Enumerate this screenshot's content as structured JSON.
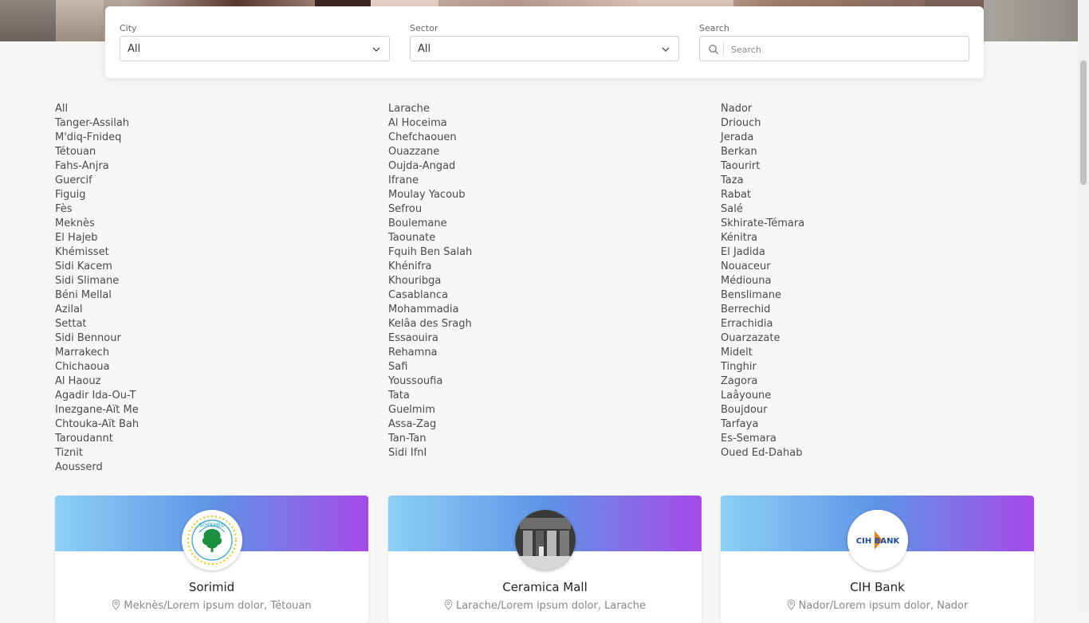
{
  "filters": {
    "city": {
      "label": "City",
      "value": "All"
    },
    "sector": {
      "label": "Sector",
      "value": "All"
    },
    "search": {
      "label": "Search",
      "placeholder": "Search"
    }
  },
  "cities": {
    "col1": [
      "All",
      "Tanger-Assilah",
      "M'diq-Fnideq",
      "Tétouan",
      "Fahs-Anjra",
      "Guercif",
      "Figuig",
      "Fès",
      "Meknès",
      "El Hajeb",
      "Khémisset",
      "Sidi Kacem",
      "Sidi Slimane",
      "Béni Mellal",
      "Azilal",
      "Settat",
      "Sidi Bennour",
      "Marrakech",
      "Chichaoua",
      "Al Haouz",
      "Agadir Ida-Ou-T",
      "Inezgane-Aït Me",
      "Chtouka-Aït Bah",
      "Taroudannt",
      "Tiznit",
      "Aousserd"
    ],
    "col2": [
      "Larache",
      "Al Hoceima",
      "Chefchaouen",
      "Ouazzane",
      "Oujda-Angad",
      "Ifrane",
      "Moulay Yacoub",
      "Sefrou",
      "Boulemane",
      "Taounate",
      "Fquih Ben Salah",
      "Khénifra",
      "Khouribga",
      "Casablanca",
      "Mohammadia",
      "Kelâa des Sragh",
      "Essaouira",
      "Rehamna",
      "Safi",
      "Youssoufia",
      "Tata",
      "Guelmim",
      "Assa-Zag",
      "Tan-Tan",
      "Sidi IfnI"
    ],
    "col3": [
      "Nador",
      "Driouch",
      "Jerada",
      "Berkan",
      "Taourirt",
      "Taza",
      "Rabat",
      "Salé",
      "Skhirate-Témara",
      "Kénitra",
      "El Jadida",
      "Nouaceur",
      "Médiouna",
      "Benslimane",
      "Berrechid",
      "Errachidia",
      "Ouarzazate",
      "Midelt",
      "Tinghir",
      "Zagora",
      "Laâyoune",
      "Boujdour",
      "Tarfaya",
      "Es-Semara",
      "Oued Ed-Dahab"
    ]
  },
  "cards": [
    {
      "name": "Sorimid",
      "address": "Meknès/Lorem ipsum dolor, Tétouan",
      "logo_text": "SOREMED",
      "logo_icon": "tree-logo-icon"
    },
    {
      "name": "Ceramica Mall",
      "address": "Larache/Lorem ipsum dolor, Larache",
      "logo_icon": "mall-photo-icon"
    },
    {
      "name": "CIH Bank",
      "address": "Nador/Lorem ipsum dolor, Nador",
      "logo_text": "CIH BANK",
      "logo_icon": "cih-logo-icon"
    }
  ],
  "colors": {
    "banner_start": "#8ed0f5",
    "banner_mid": "#5e95e6",
    "banner_end": "#a64ae8",
    "soremed_green": "#1a8f3e",
    "cih_orange": "#f0821e",
    "cih_blue": "#1f4fa3"
  }
}
